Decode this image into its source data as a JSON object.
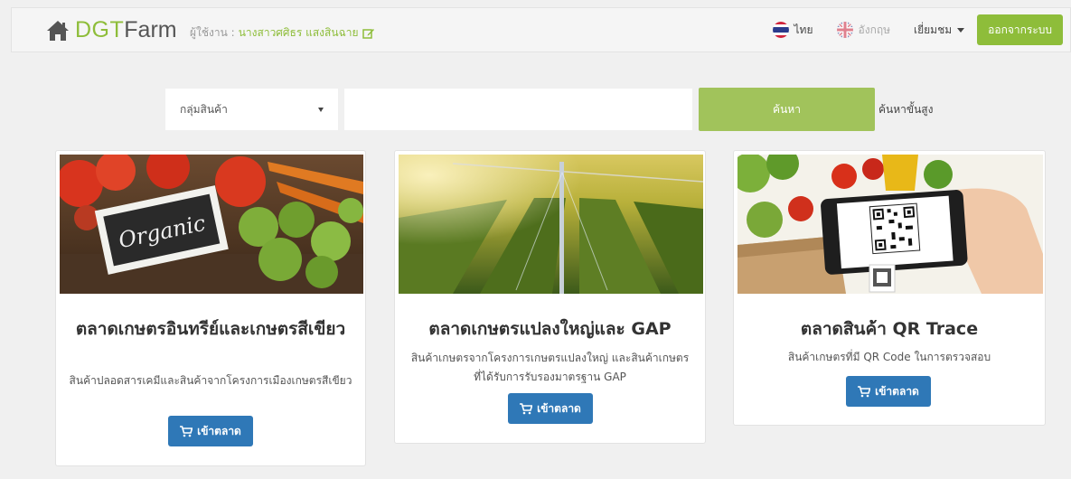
{
  "brand": {
    "part1": "DGT",
    "part2": "Farm"
  },
  "user": {
    "label": "ผู้ใช้งาน :",
    "name": "นางสาวศศิธร แสงสินฉาย"
  },
  "nav": {
    "lang_th": "ไทย",
    "lang_en": "อังกฤษ",
    "visitor": "เยี่ยมชม",
    "logout": "ออกจากระบบ"
  },
  "search": {
    "category_value": "กลุ่มสินค้า",
    "input_value": "",
    "button": "ค้นหา",
    "advanced": "ค้นหาขั้นสูง"
  },
  "cards": [
    {
      "title": "ตลาดเกษตรอินทรีย์และเกษตรสีเขียว",
      "description": "สินค้าปลอดสารเคมีและสินค้าจากโครงการเมืองเกษตรสีเขียว",
      "button": "เข้าตลาด",
      "image_text": "Organic"
    },
    {
      "title": "ตลาดเกษตรแปลงใหญ่และ GAP",
      "description": "สินค้าเกษตรจากโครงการเกษตรแปลงใหญ่ และสินค้าเกษตรที่ได้รับการรับรองมาตรฐาน GAP",
      "button": "เข้าตลาด"
    },
    {
      "title": "ตลาดสินค้า QR Trace",
      "description": "สินค้าเกษตรที่มี QR Code ในการตรวจสอบ",
      "button": "เข้าตลาด"
    }
  ],
  "colors": {
    "brand_green": "#8ebd3a",
    "button_blue": "#2f78b7",
    "search_green": "#a1c35b"
  }
}
